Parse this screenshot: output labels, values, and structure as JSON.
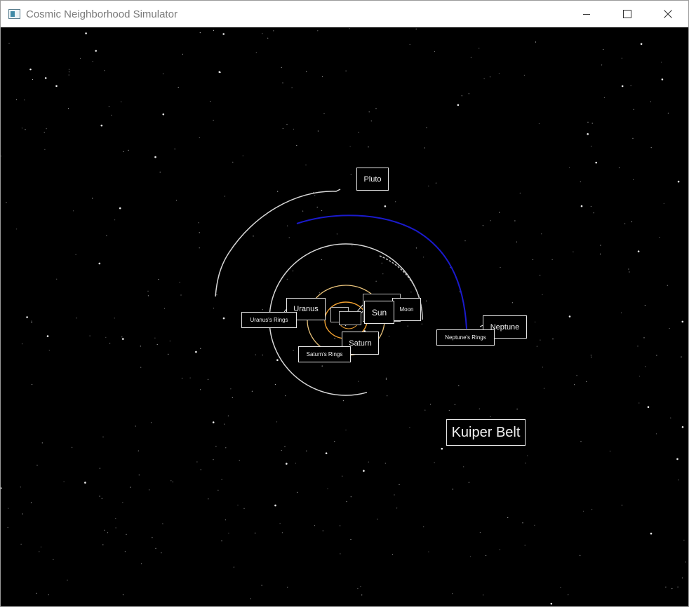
{
  "window": {
    "title": "Cosmic Neighborhood Simulator",
    "controls": {
      "minimize": "minimize-icon",
      "maximize": "maximize-icon",
      "close": "close-icon"
    }
  },
  "scene": {
    "background_color": "#000000",
    "orbit_colors": {
      "inner": "#f0a030",
      "neptune": "#1a1acc",
      "default": "#d8d8d8"
    },
    "labels": {
      "pluto": "Pluto",
      "uranus": "Uranus",
      "uranus_rings": "Uranus's Rings",
      "sun": "Sun",
      "moon": "Moon",
      "saturn": "Saturn",
      "saturn_rings": "Saturn's Rings",
      "neptune": "Neptune",
      "neptune_rings": "Neptune's Rings",
      "kuiper_belt": "Kuiper Belt"
    }
  }
}
